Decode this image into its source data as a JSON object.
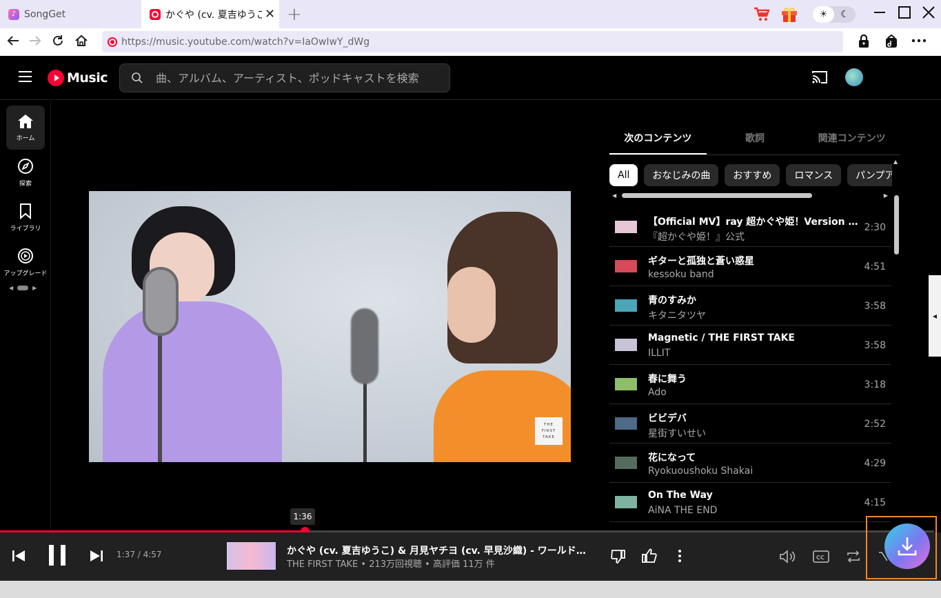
{
  "browser": {
    "tabs": [
      {
        "title": "SongGet"
      },
      {
        "title": "かぐや (cv. 夏吉ゆうこ) &"
      }
    ],
    "url": "https://music.youtube.com/watch?v=IaOwIwY_dWg"
  },
  "app": {
    "logo_text": "Music",
    "search_placeholder": "曲、アルバム、アーティスト、ポッドキャストを検索",
    "sidebar": [
      {
        "label": "ホーム"
      },
      {
        "label": "探索"
      },
      {
        "label": "ライブラリ"
      },
      {
        "label": "アップグレード"
      }
    ],
    "video_watermark": [
      "THE",
      "FIRST",
      "TAKE"
    ],
    "panel_tabs": [
      "次のコンテンツ",
      "歌詞",
      "関連コンテンツ"
    ],
    "chips": [
      "All",
      "おなじみの曲",
      "おすすめ",
      "ロマンス",
      "パンプアップ"
    ],
    "queue": [
      {
        "title": "【Official MV】ray 超かぐや姫！Version / かぐや (cv. 夏吉ゆうこ)",
        "artist": "『超かぐや姫！』公式",
        "duration": "2:30",
        "thumb_color": "#e7c7d6"
      },
      {
        "title": "ギターと孤独と蒼い惑星",
        "artist": "kessoku band",
        "duration": "4:51",
        "thumb_color": "#d64a5a"
      },
      {
        "title": "青のすみか",
        "artist": "キタニタツヤ",
        "duration": "3:58",
        "thumb_color": "#4aa6b8"
      },
      {
        "title": "Magnetic / THE FIRST TAKE",
        "artist": "ILLIT",
        "duration": "3:58",
        "thumb_color": "#c9c3d6"
      },
      {
        "title": "春に舞う",
        "artist": "Ado",
        "duration": "3:18",
        "thumb_color": "#8dbf6a"
      },
      {
        "title": "ビビデバ",
        "artist": "星街すいせい",
        "duration": "2:52",
        "thumb_color": "#4d6a86"
      },
      {
        "title": "花になって",
        "artist": "Ryokuoushoku Shakai",
        "duration": "4:29",
        "thumb_color": "#556b5e"
      },
      {
        "title": "On The Way",
        "artist": "AiNA THE END",
        "duration": "4:15",
        "thumb_color": "#7fb3a1"
      }
    ]
  },
  "player": {
    "tooltip_time": "1:36",
    "time_display": "1:37 / 4:57",
    "progress": 0.326,
    "title": "かぐや (cv. 夏吉ゆうこ) & 月見ヤチヨ (cv. 早見沙織) - ワールドイズマイン / THE FIRST TAKE",
    "subtitle": "THE FIRST TAKE • 213万回視聴 • 高評価 11万 件"
  },
  "colors": {
    "accent": "#ff0033",
    "download_frame": "#f08a24"
  }
}
